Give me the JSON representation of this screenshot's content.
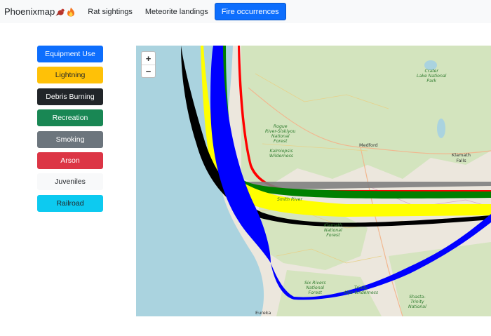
{
  "navbar": {
    "brand": "Phoenixmap",
    "brand_icons": [
      "bird-icon",
      "fire-icon"
    ],
    "links": [
      {
        "label": "Rat sightings",
        "active": false
      },
      {
        "label": "Meteorite landings",
        "active": false
      },
      {
        "label": "Fire occurrences",
        "active": true
      }
    ]
  },
  "sidebar": {
    "buttons": [
      {
        "label": "Equipment Use",
        "bg": "#0d6efd",
        "fg": "#ffffff"
      },
      {
        "label": "Lightning",
        "bg": "#ffc107",
        "fg": "#212529"
      },
      {
        "label": "Debris Burning",
        "bg": "#212529",
        "fg": "#ffffff"
      },
      {
        "label": "Recreation",
        "bg": "#198754",
        "fg": "#ffffff"
      },
      {
        "label": "Smoking",
        "bg": "#6c757d",
        "fg": "#ffffff"
      },
      {
        "label": "Arson",
        "bg": "#dc3545",
        "fg": "#ffffff"
      },
      {
        "label": "Juveniles",
        "bg": "#f8f9fa",
        "fg": "#212529"
      },
      {
        "label": "Railroad",
        "bg": "#0dcaf0",
        "fg": "#212529"
      }
    ]
  },
  "map": {
    "zoom_in": "+",
    "zoom_out": "−",
    "labels": {
      "crater_lake": "Crater\nLake National\nPark",
      "rogue_river": "Rogue\nRiver-Siskiyou\nNational\nForest",
      "kalmiopsis": "Kalmiopsis\nWilderness",
      "medford": "Medford",
      "klamath_falls": "Klamath\nFalls",
      "smith_river": "Smith River",
      "klamath_forest": "Klamath\nNational\nForest",
      "six_rivers": "Six Rivers\nNational\nForest",
      "trinity_alps": "Trinity\nAlps Wilderness",
      "shasta_trinity": "Shasta-\nTrinity\nNational",
      "eureka": "Eureka"
    },
    "colors": {
      "ocean": "#aad3df",
      "land": "#ece7dd",
      "forest": "#cfe3b8",
      "equipment_use": "#0000ff",
      "lightning": "#ffff00",
      "debris_burning": "#000000",
      "recreation": "#008000",
      "smoking": "#808080",
      "arson": "#ff0000"
    }
  }
}
